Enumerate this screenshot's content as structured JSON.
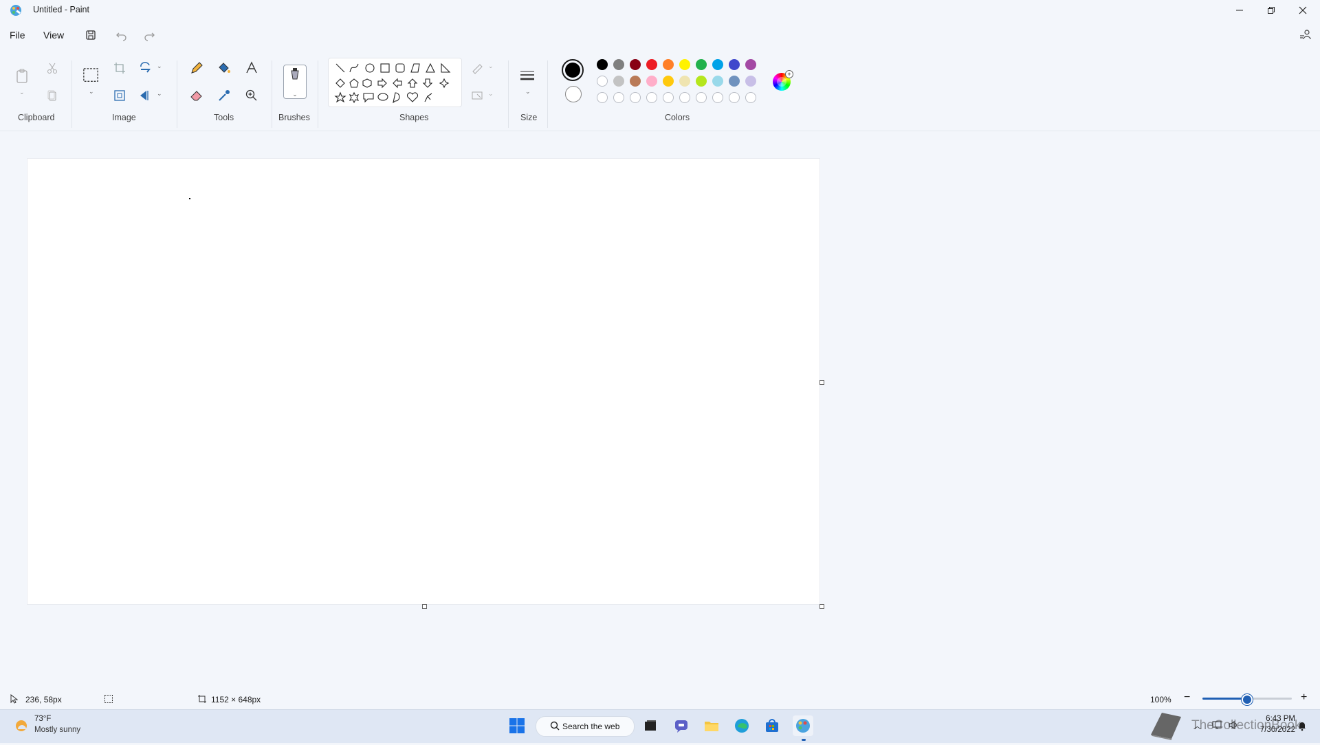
{
  "window": {
    "title": "Untitled - Paint",
    "app_icon": "paint-icon",
    "controls": {
      "minimize": "minimize-icon",
      "maximize": "restore-icon",
      "close": "close-icon"
    }
  },
  "menu": {
    "items": [
      "File",
      "View"
    ],
    "quick_actions": [
      "save-icon",
      "undo-icon",
      "redo-icon"
    ],
    "account_icon": "account-icon"
  },
  "ribbon": {
    "groups": {
      "clipboard": "Clipboard",
      "image": "Image",
      "tools": "Tools",
      "brushes": "Brushes",
      "shapes": "Shapes",
      "size": "Size",
      "colors": "Colors"
    },
    "selected_primary_color": "#000000",
    "selected_secondary_color": "#ffffff",
    "palette_row1": [
      "#000000",
      "#7f7f7f",
      "#880015",
      "#ed1c24",
      "#ff7f27",
      "#fff200",
      "#22b14c",
      "#00a2e8",
      "#3f48cc",
      "#a349a4"
    ],
    "palette_row2": [
      "#ffffff",
      "#c3c3c3",
      "#b97a57",
      "#ffaec9",
      "#ffc90e",
      "#efe4b0",
      "#b5e61d",
      "#99d9ea",
      "#7092be",
      "#c8bfe7"
    ]
  },
  "status": {
    "cursor_position": "236, 58px",
    "canvas_size": "1152 × 648px",
    "zoom": "100%",
    "zoom_fraction": 0.5
  },
  "taskbar": {
    "weather_temp": "73°F",
    "weather_desc": "Mostly sunny",
    "search_label": "Search the web",
    "time": "6:43 PM",
    "date": "7/30/2022",
    "watermark": "TheCollectionBook"
  }
}
